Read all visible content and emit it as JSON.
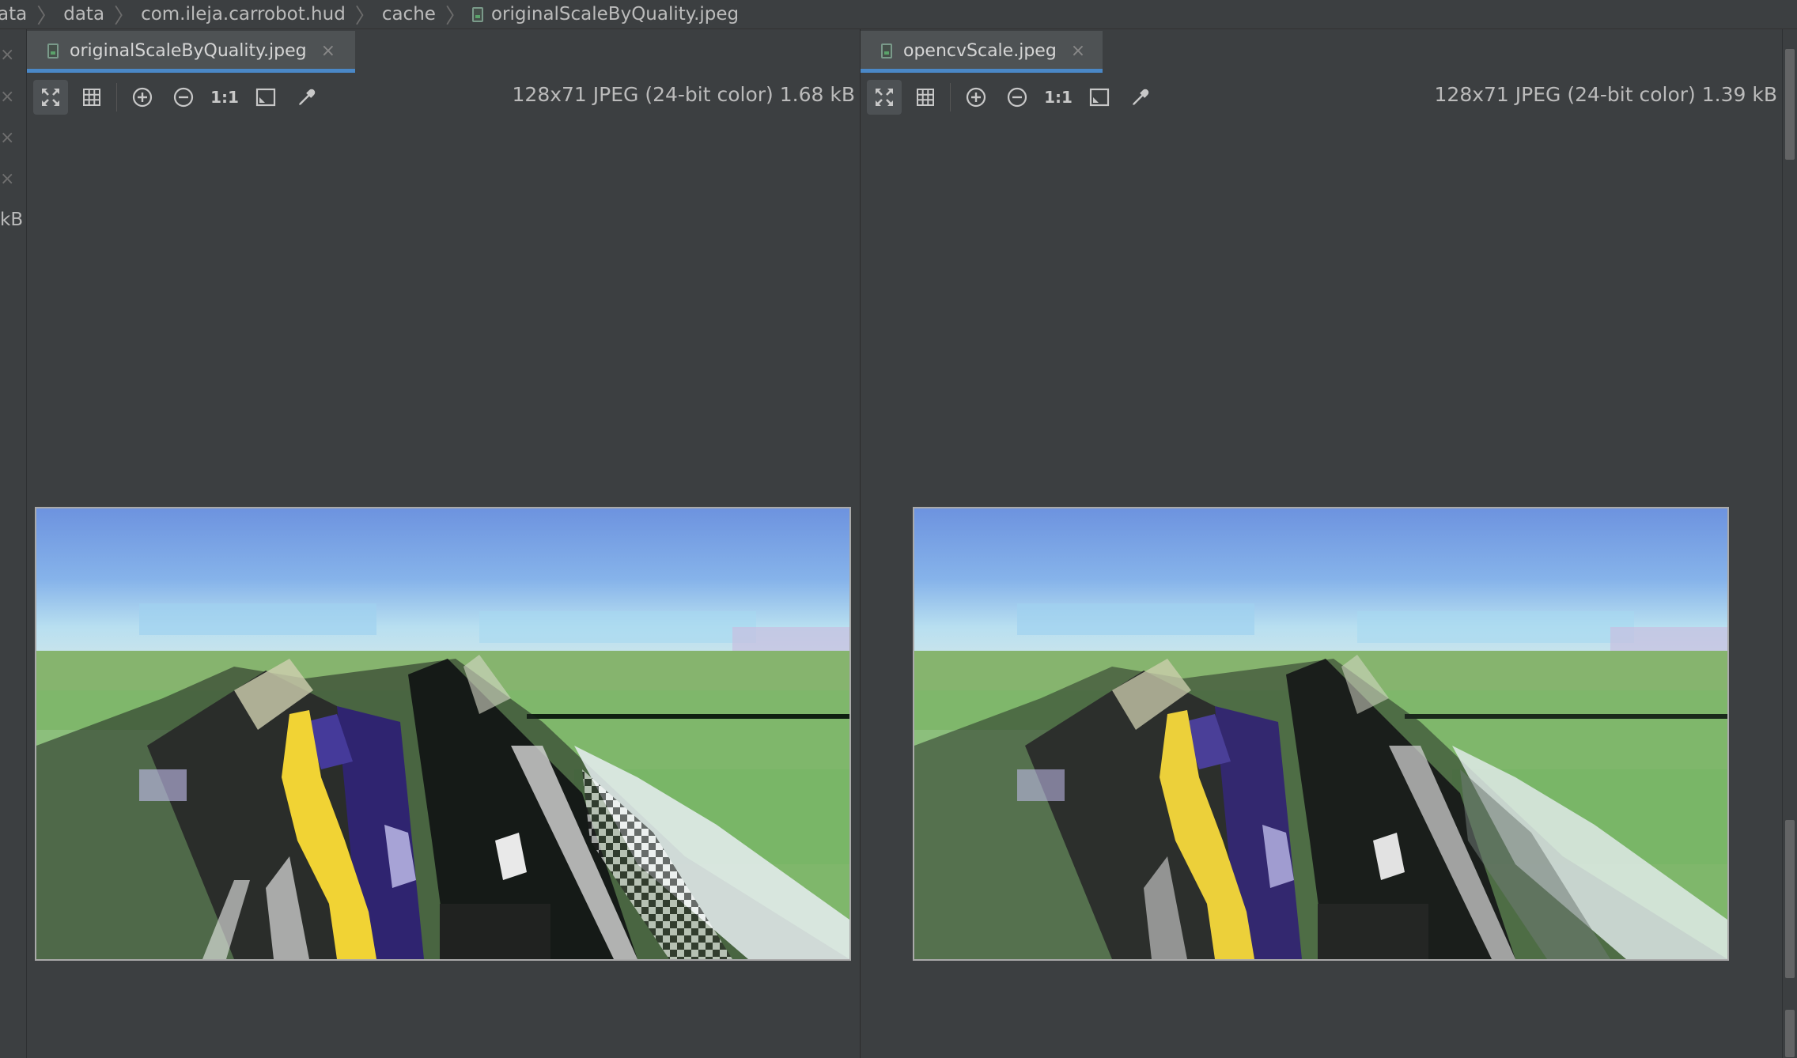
{
  "breadcrumb": {
    "items": [
      "ata",
      "data",
      "com.ileja.carrobot.hud",
      "cache",
      "originalScaleByQuality.jpeg"
    ]
  },
  "left_strip": {
    "size_fragment": "kB"
  },
  "left_pane": {
    "tab_label": "originalScaleByQuality.jpeg",
    "image_info": "128x71 JPEG (24-bit color) 1.68 kB",
    "zoom_label": "1:1"
  },
  "right_pane": {
    "tab_label": "opencvScale.jpeg",
    "image_info": "128x71 JPEG (24-bit color) 1.39 kB",
    "zoom_label": "1:1"
  },
  "colors": {
    "background": "#3c3f41",
    "tab_active": "#4e5254",
    "tab_underline": "#4a88c7",
    "text": "#bbbbbb"
  },
  "icons": [
    "file-jpeg-icon",
    "close-icon",
    "fit-zoom-icon",
    "grid-icon",
    "zoom-in-icon",
    "zoom-out-icon",
    "actual-size-icon",
    "background-icon",
    "color-picker-icon"
  ]
}
